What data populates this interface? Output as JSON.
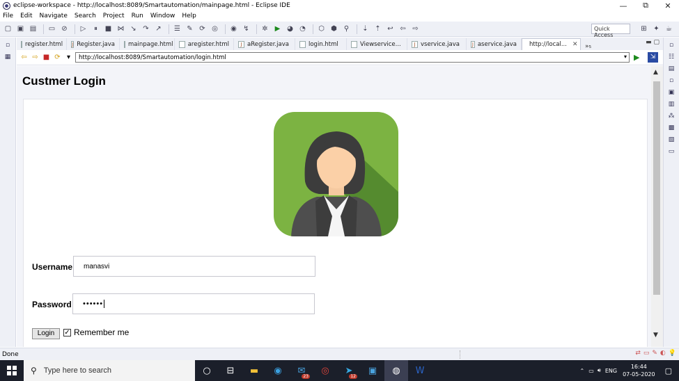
{
  "window": {
    "title": "eclipse-workspace - http://localhost:8089/Smartautomation/mainpage.html - Eclipse IDE",
    "min": "—",
    "max": "⧉",
    "close": "✕"
  },
  "menu": [
    "File",
    "Edit",
    "Navigate",
    "Search",
    "Project",
    "Run",
    "Window",
    "Help"
  ],
  "toolbar": {
    "quick_access": "Quick Access"
  },
  "tabs": [
    {
      "label": "register.html",
      "icon": "html-file-icon",
      "active": false
    },
    {
      "label": "Register.java",
      "icon": "java-file-icon",
      "active": false
    },
    {
      "label": "mainpage.html",
      "icon": "html-file-icon",
      "active": false
    },
    {
      "label": "aregister.html",
      "icon": "html-file-icon",
      "active": false
    },
    {
      "label": "aRegister.java",
      "icon": "java-file-icon",
      "active": false
    },
    {
      "label": "login.html",
      "icon": "html-file-icon",
      "active": false
    },
    {
      "label": "Viewservice...",
      "icon": "html-file-icon",
      "active": false
    },
    {
      "label": "vservice.java",
      "icon": "java-file-icon",
      "active": false
    },
    {
      "label": "aservice.java",
      "icon": "java-file-icon",
      "active": false
    },
    {
      "label": "http://local...",
      "icon": "globe-icon",
      "active": true
    }
  ],
  "tab_overflow": "»₅",
  "browser": {
    "url": "http://localhost:8089/Smartautomation/login.html"
  },
  "page": {
    "title": "Custmer Login",
    "username_label": "Username",
    "username_value": "manasvi",
    "password_label": "Password",
    "password_value": "••••••",
    "login_button": "Login",
    "remember_label": "Remember me",
    "remember_checked": true,
    "avatar_bg": "#7cb342",
    "avatar_bg_dark": "#558b2f"
  },
  "status": {
    "text": "Done"
  },
  "taskbar": {
    "search_placeholder": "Type here to search",
    "mail_badge": "23",
    "telegram_badge": "12",
    "lang": "ENG",
    "time": "16:44",
    "date": "07-05-2020"
  }
}
